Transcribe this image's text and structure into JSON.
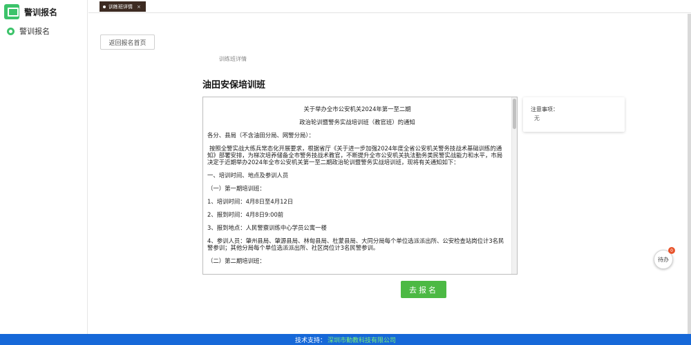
{
  "sidebar": {
    "title": "警训报名",
    "items": [
      {
        "label": "警训报名",
        "icon": "circle-dot-icon"
      }
    ]
  },
  "tabs": [
    {
      "label": "训练班详情",
      "close": "×"
    }
  ],
  "main": {
    "back_button": "返回报名首页",
    "detail_label": "训练班详情",
    "class_title": "油田安保培训班",
    "notice": {
      "title_line1": "关于举办全市公安机关2024年第一至二期",
      "title_line2": "政治轮训暨警务实战培训班（教官班）的通知",
      "addressee": "各分、县局（不含油田分局、网警分局）：",
      "intro": "按照全警实战大练兵常态化开展要求，根据省厅《关于进一步加强2024年度全省公安机关警务技战术基础训练的通知》部署安排，为梯次培养储备全市警务技战术教官，不断提升全市公安机关执法勤务类民警实战能力和水平，市局决定于近期举办2024年全市公安机关第一至二期政治轮训暨警务实战培训班，现将有关通知如下：",
      "section1": "一、培训时间、地点及参训人员",
      "sub1": "（一）第一期培训班：",
      "item1": "1、培训时间：4月8日至4月12日",
      "item2": "2、报到时间：4月8日9:00前",
      "item3": "3、报到地点：人民警察训练中心学员公寓一楼",
      "item4": "4、参训人员：肇州县局、肇源县局、林甸县局、杜蒙县局、大同分局每个单位选派派出所、公安检查站岗位计3名民警参训；其他分局每个单位选派派出所、社区岗位计3名民警参训。",
      "sub2": "（二）第二期培训班："
    },
    "notes_label": "注意事项：",
    "notes_value": "无",
    "signup_button": "去报名"
  },
  "float": {
    "todo_label": "待办",
    "todo_count": "0"
  },
  "footer": {
    "prefix": "技术支持：",
    "company": "深圳市勤教科技有限公司"
  },
  "colors": {
    "accent_green": "#4cb944",
    "sidebar_green": "#3cc36a",
    "footer_blue": "#1668d8",
    "tab_dark": "#3d2b22",
    "badge_red": "#e8532b"
  }
}
